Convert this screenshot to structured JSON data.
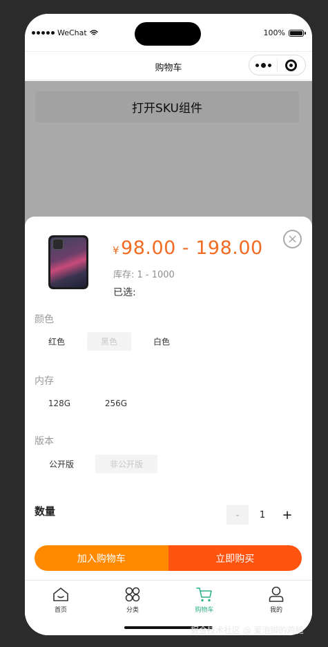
{
  "status_bar": {
    "carrier": "WeChat",
    "battery": "100%"
  },
  "navbar": {
    "title": "购物车"
  },
  "page": {
    "open_sku_button": "打开SKU组件"
  },
  "sku": {
    "price": {
      "symbol": "¥",
      "range": "98.00 - 198.00"
    },
    "stock": "库存: 1 - 1000",
    "selected": "已选:",
    "groups": [
      {
        "title": "颜色",
        "options": [
          {
            "label": "红色",
            "disabled": false
          },
          {
            "label": "黑色",
            "disabled": true
          },
          {
            "label": "白色",
            "disabled": false
          }
        ]
      },
      {
        "title": "内存",
        "options": [
          {
            "label": "128G",
            "disabled": false
          },
          {
            "label": "256G",
            "disabled": false
          }
        ]
      },
      {
        "title": "版本",
        "options": [
          {
            "label": "公开版",
            "disabled": false
          },
          {
            "label": "非公开版",
            "disabled": true
          }
        ]
      }
    ],
    "quantity": {
      "label": "数量",
      "value": "1",
      "minus": "-",
      "plus": "+"
    },
    "actions": {
      "add_to_cart": "加入购物车",
      "buy_now": "立即购买"
    },
    "colors": {
      "price": "#f26b22",
      "cart_button": "#ff8a00",
      "buy_button": "#ff5410"
    }
  },
  "tabbar": {
    "items": [
      {
        "label": "首页",
        "icon": "home-icon",
        "active": false
      },
      {
        "label": "分类",
        "icon": "category-icon",
        "active": false
      },
      {
        "label": "购物车",
        "icon": "cart-icon",
        "active": true
      },
      {
        "label": "我的",
        "icon": "profile-icon",
        "active": false
      }
    ],
    "active_color": "#2bb08a"
  },
  "watermark": "掘金技术社区 @ 爱泡脚的鸡腿"
}
